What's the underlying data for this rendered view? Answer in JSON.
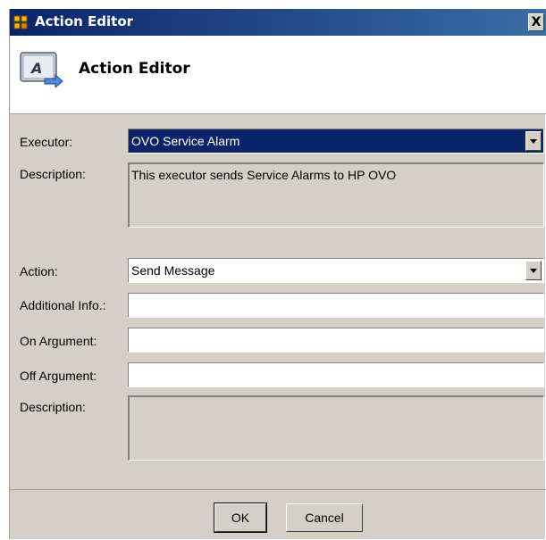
{
  "window": {
    "title": "Action Editor",
    "close_label": "X"
  },
  "header": {
    "title": "Action Editor",
    "icon": "action-editor-icon",
    "icon_letter": "A"
  },
  "form": {
    "executor_label": "Executor:",
    "executor_value": "OVO Service Alarm",
    "executor_description_label": "Description:",
    "executor_description": "This executor sends Service Alarms to HP OVO",
    "action_label": "Action:",
    "action_value": "Send Message",
    "additional_info_label": "Additional Info.:",
    "additional_info_value": "",
    "on_argument_label": "On Argument:",
    "on_argument_value": "",
    "off_argument_label": "Off Argument:",
    "off_argument_value": "",
    "action_description_label": "Description:",
    "action_description": ""
  },
  "buttons": {
    "ok_label": "OK",
    "cancel_label": "Cancel"
  },
  "colors": {
    "titlebar": "#0a246a",
    "dialog_bg": "#d4d0c8",
    "selection": "#0a246a"
  }
}
